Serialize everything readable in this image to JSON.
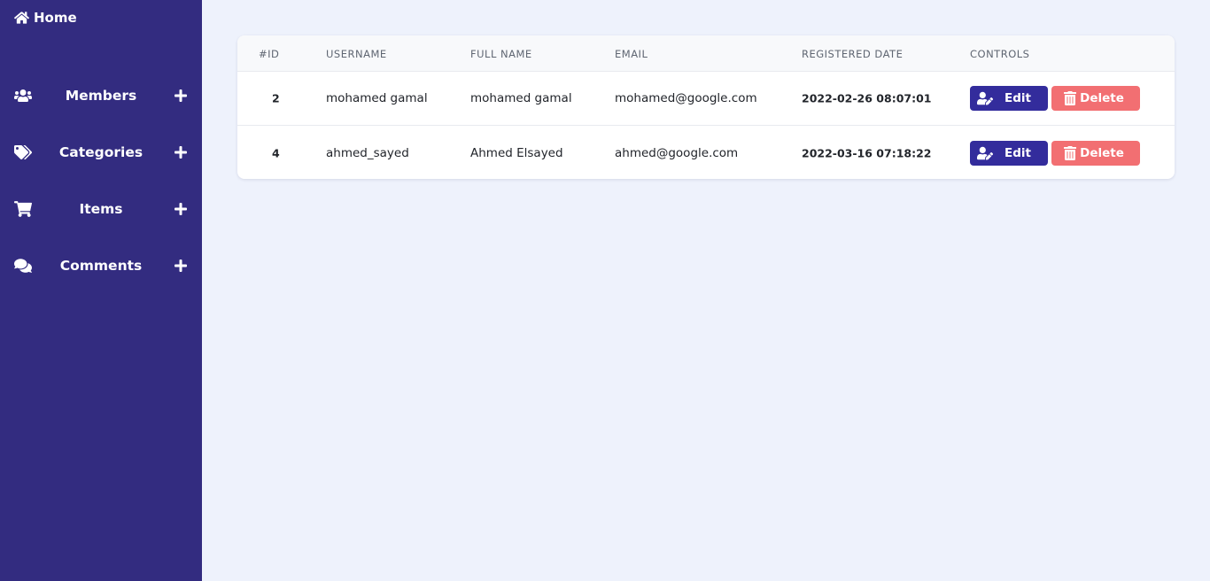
{
  "sidebar": {
    "home_label": "Home",
    "items": [
      {
        "label": "Members",
        "icon": "users-icon"
      },
      {
        "label": "Categories",
        "icon": "tags-icon"
      },
      {
        "label": "Items",
        "icon": "cart-icon"
      },
      {
        "label": "Comments",
        "icon": "comments-icon"
      }
    ],
    "add_icon": "plus-icon"
  },
  "table": {
    "headers": [
      "#ID",
      "USERNAME",
      "FULL NAME",
      "EMAIL",
      "REGISTERED DATE",
      "CONTROLS"
    ],
    "rows": [
      {
        "id": "2",
        "username": "mohamed gamal",
        "full_name": "mohamed gamal",
        "email": "mohamed@google.com",
        "registered": "2022-02-26 08:07:01"
      },
      {
        "id": "4",
        "username": "ahmed_sayed",
        "full_name": "Ahmed Elsayed",
        "email": "ahmed@google.com",
        "registered": "2022-03-16 07:18:22"
      }
    ],
    "edit_label": "Edit",
    "delete_label": "Delete"
  },
  "colors": {
    "sidebar_bg": "#332c80",
    "page_bg": "#eef2fc",
    "edit_button": "#332c9c",
    "delete_button": "#f26f72"
  }
}
